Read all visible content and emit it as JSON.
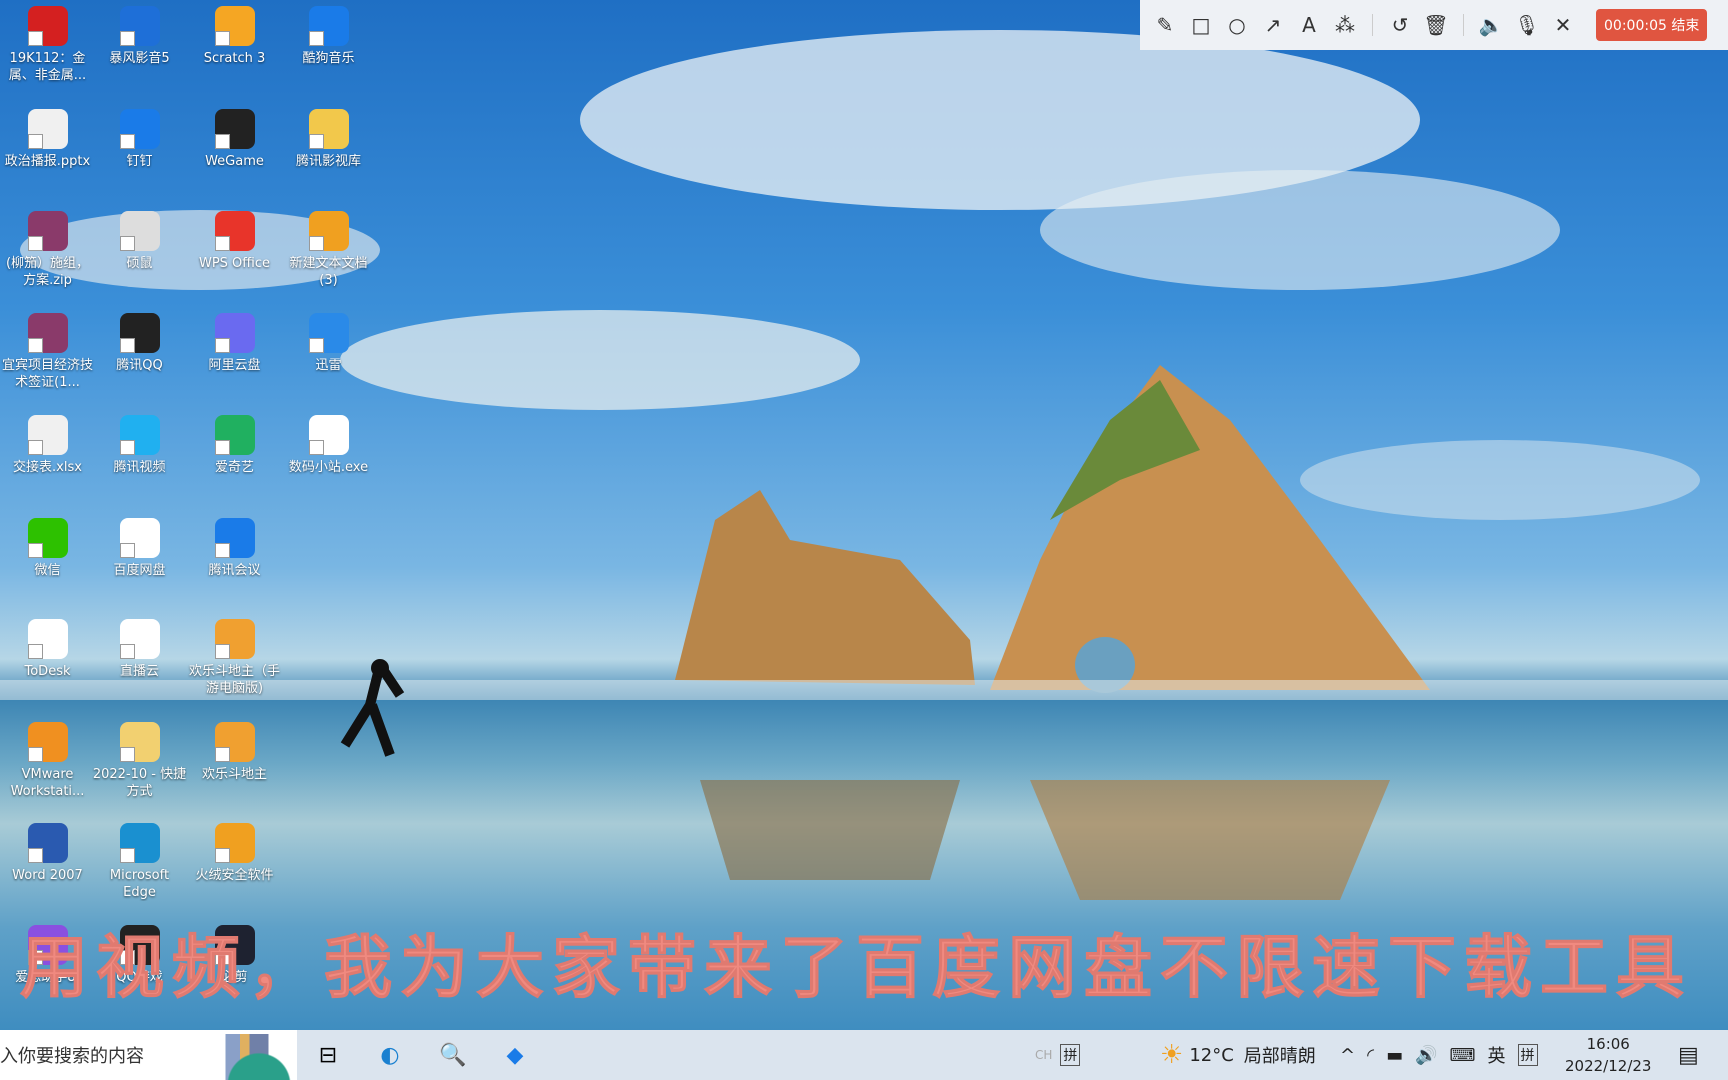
{
  "desktop": {
    "icons": [
      {
        "label": "19K112：金属、非金属...",
        "icon": "pdf-icon",
        "color": "#d42020"
      },
      {
        "label": "暴风影音5",
        "icon": "player-icon",
        "color": "#1e6fd8"
      },
      {
        "label": "Scratch 3",
        "icon": "scratch-icon",
        "color": "#f5a623"
      },
      {
        "label": "酷狗音乐",
        "icon": "kugou-icon",
        "color": "#1a7be8"
      },
      {
        "label": "政治播报.pptx",
        "icon": "pptx-icon",
        "color": "#f0f0f0"
      },
      {
        "label": "钉钉",
        "icon": "dingtalk-icon",
        "color": "#1a7be8"
      },
      {
        "label": "WeGame",
        "icon": "wegame-icon",
        "color": "#222"
      },
      {
        "label": "腾讯影视库",
        "icon": "folder-icon",
        "color": "#f2c84b"
      },
      {
        "label": "(柳笳）施组，方案.zip",
        "icon": "winrar-icon",
        "color": "#8a3a6a"
      },
      {
        "label": "硕鼠",
        "icon": "mouse-icon",
        "color": "#ddd"
      },
      {
        "label": "WPS Office",
        "icon": "wps-icon",
        "color": "#e8342a"
      },
      {
        "label": "新建文本文档(3)",
        "icon": "qq-icon",
        "color": "#f0a020"
      },
      {
        "label": "宜宾项目经济技术签证(1...",
        "icon": "winrar-icon",
        "color": "#8a3a6a"
      },
      {
        "label": "腾讯QQ",
        "icon": "qq-icon",
        "color": "#222"
      },
      {
        "label": "阿里云盘",
        "icon": "aliyun-icon",
        "color": "#6a6af0"
      },
      {
        "label": "迅雷",
        "icon": "thunder-icon",
        "color": "#2a8ae8"
      },
      {
        "label": "交接表.xlsx",
        "icon": "xlsx-icon",
        "color": "#f0f0f0"
      },
      {
        "label": "腾讯视频",
        "icon": "tencent-video-icon",
        "color": "#20b0f0"
      },
      {
        "label": "爱奇艺",
        "icon": "iqiyi-icon",
        "color": "#20b060"
      },
      {
        "label": "数码小站.exe",
        "icon": "cloud-icon",
        "color": "#ffffff"
      },
      {
        "label": "微信",
        "icon": "wechat-icon",
        "color": "#2dc100"
      },
      {
        "label": "百度网盘",
        "icon": "baidu-netdisk-icon",
        "color": "#ffffff"
      },
      {
        "label": "腾讯会议",
        "icon": "tencent-meeting-icon",
        "color": "#1a7be8"
      },
      {
        "label": "ToDesk",
        "icon": "todesk-icon",
        "color": "#ffffff"
      },
      {
        "label": "直播云",
        "icon": "live-icon",
        "color": "#ffffff"
      },
      {
        "label": "欢乐斗地主（手游电脑版)",
        "icon": "game-icon",
        "color": "#f0a030"
      },
      {
        "label": "VMware Workstati...",
        "icon": "vmware-icon",
        "color": "#f09020"
      },
      {
        "label": "2022-10 - 快捷方式",
        "icon": "folder-icon",
        "color": "#f2d070"
      },
      {
        "label": "欢乐斗地主",
        "icon": "game-icon",
        "color": "#f0a030"
      },
      {
        "label": "Word 2007",
        "icon": "word-icon",
        "color": "#2a5ab0"
      },
      {
        "label": "Microsoft Edge",
        "icon": "edge-icon",
        "color": "#1a90d0"
      },
      {
        "label": "火绒安全软件",
        "icon": "huorong-icon",
        "color": "#f0a020"
      },
      {
        "label": "爱思助手8.",
        "icon": "aisi-icon",
        "color": "#8a50e0"
      },
      {
        "label": "QQ游戏",
        "icon": "qq-game-icon",
        "color": "#222"
      },
      {
        "label": "必剪",
        "icon": "bijian-icon",
        "color": "#1e2230"
      }
    ]
  },
  "subtitle": "用视频，我为大家带来了百度网盘不限速下载工具",
  "recorder": {
    "tools": [
      "pencil-icon",
      "rectangle-icon",
      "circle-icon",
      "arrow-icon",
      "text-icon",
      "magic-wand-icon",
      "undo-icon",
      "trash-icon",
      "speaker-icon",
      "microphone-icon",
      "close-icon"
    ],
    "timer": "00:00:05 结束",
    "accent": "#e05540"
  },
  "taskbar": {
    "search_placeholder": "入你要搜索的内容",
    "ime1": "CH",
    "ime2": "拼",
    "temperature": "12°C",
    "weather": "局部晴朗",
    "lang": "英",
    "ime3": "拼",
    "time": "16:06",
    "date": "2022/12/23"
  }
}
